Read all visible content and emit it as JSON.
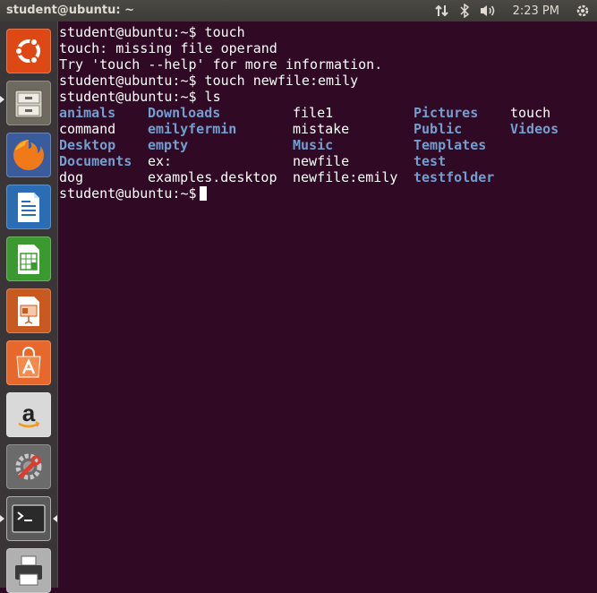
{
  "top_panel": {
    "window_title": "student@ubuntu: ~",
    "clock": "2:23 PM",
    "icons": [
      "network-arrows-icon",
      "bluetooth-icon",
      "volume-icon",
      "power-gear-icon"
    ]
  },
  "launcher": {
    "items": [
      {
        "name": "ubuntu-dash",
        "icon": "ubuntu-logo-icon",
        "bg": "#dd4814"
      },
      {
        "name": "files",
        "icon": "file-cabinet-icon",
        "bg": "#6f6a5f"
      },
      {
        "name": "firefox",
        "icon": "firefox-icon",
        "bg": "#e66000"
      },
      {
        "name": "libreoffice-writer",
        "icon": "writer-doc-icon",
        "bg": "#2a6db5"
      },
      {
        "name": "libreoffice-calc",
        "icon": "calc-sheet-icon",
        "bg": "#3b9a2f"
      },
      {
        "name": "libreoffice-impress",
        "icon": "impress-slide-icon",
        "bg": "#c85a1f"
      },
      {
        "name": "software-center",
        "icon": "shopping-bag-icon",
        "bg": "#e8672a"
      },
      {
        "name": "amazon",
        "icon": "amazon-logo-icon",
        "bg": "#d9d9d9"
      },
      {
        "name": "system-settings",
        "icon": "settings-wrench-icon",
        "bg": "#6b6b6b"
      },
      {
        "name": "terminal",
        "icon": "terminal-icon",
        "bg": "#5a5a5a"
      },
      {
        "name": "printer",
        "icon": "printer-icon",
        "bg": "#b0b0b0"
      }
    ]
  },
  "terminal": {
    "prompt": "student@ubuntu:~$",
    "lines": [
      "student@ubuntu:~$ touch",
      "touch: missing file operand",
      "Try 'touch --help' for more information.",
      "student@ubuntu:~$ touch newfile:emily",
      "student@ubuntu:~$ ls"
    ],
    "ls_rows": [
      [
        {
          "t": "animals",
          "d": true
        },
        {
          "t": "Downloads",
          "d": true
        },
        {
          "t": "file1",
          "d": false
        },
        {
          "t": "Pictures",
          "d": true
        },
        {
          "t": "touch",
          "d": false
        }
      ],
      [
        {
          "t": "command",
          "d": false
        },
        {
          "t": "emilyfermin",
          "d": true
        },
        {
          "t": "mistake",
          "d": false
        },
        {
          "t": "Public",
          "d": true
        },
        {
          "t": "Videos",
          "d": true
        }
      ],
      [
        {
          "t": "Desktop",
          "d": true
        },
        {
          "t": "empty",
          "d": true
        },
        {
          "t": "Music",
          "d": true
        },
        {
          "t": "Templates",
          "d": true
        },
        {
          "t": "",
          "d": false
        }
      ],
      [
        {
          "t": "Documents",
          "d": true
        },
        {
          "t": "ex:",
          "d": false
        },
        {
          "t": "newfile",
          "d": false
        },
        {
          "t": "test",
          "d": true
        },
        {
          "t": "",
          "d": false
        }
      ],
      [
        {
          "t": "dog",
          "d": false
        },
        {
          "t": "examples.desktop",
          "d": false
        },
        {
          "t": "newfile:emily",
          "d": false
        },
        {
          "t": "testfolder",
          "d": true
        },
        {
          "t": "",
          "d": false
        }
      ]
    ],
    "dir_color": "#729fcf",
    "background": "#300a24"
  }
}
